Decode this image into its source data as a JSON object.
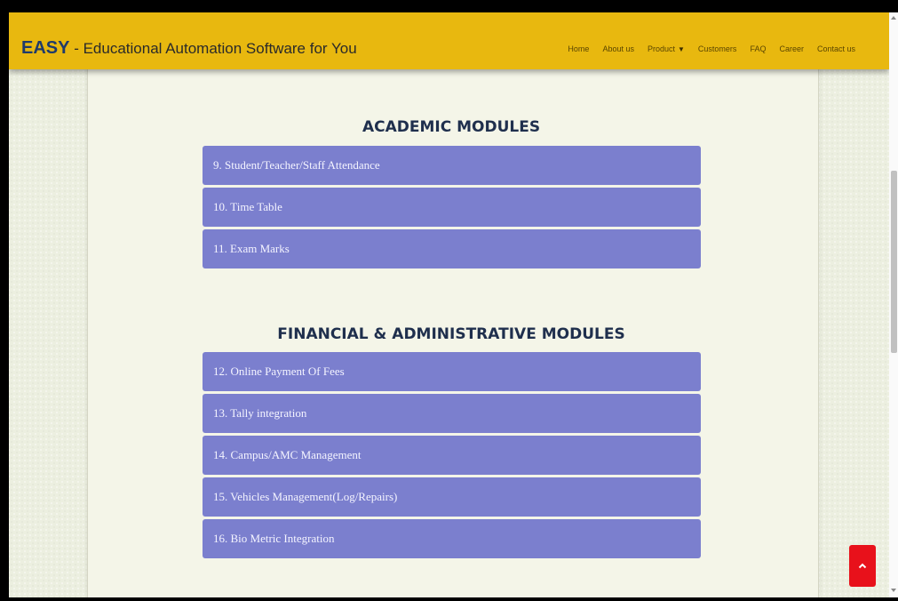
{
  "navbar": {
    "brand_name": "EASY",
    "brand_tagline": " - Educational Automation Software for You",
    "links": [
      "Home",
      "About us",
      "Product",
      "Customers",
      "FAQ",
      "Career",
      "Contact us"
    ]
  },
  "academic": {
    "title": "ACADEMIC MODULES",
    "items": [
      "9. Student/Teacher/Staff Attendance",
      "10. Time Table",
      "11. Exam Marks"
    ]
  },
  "financial": {
    "title": "FINANCIAL & ADMINISTRATIVE MODULES",
    "items": [
      "12. Online Payment Of Fees",
      "13. Tally integration",
      "14. Campus/AMC Management",
      "15. Vehicles Management(Log/Repairs)",
      "16. Bio Metric Integration"
    ]
  },
  "colors": {
    "navbar": "#e8b80f",
    "module_item": "#7b7fce",
    "back_to_top": "#e8111b"
  },
  "icons": {
    "dropdown": "chevron-down-icon",
    "back_to_top": "chevron-up-icon"
  }
}
